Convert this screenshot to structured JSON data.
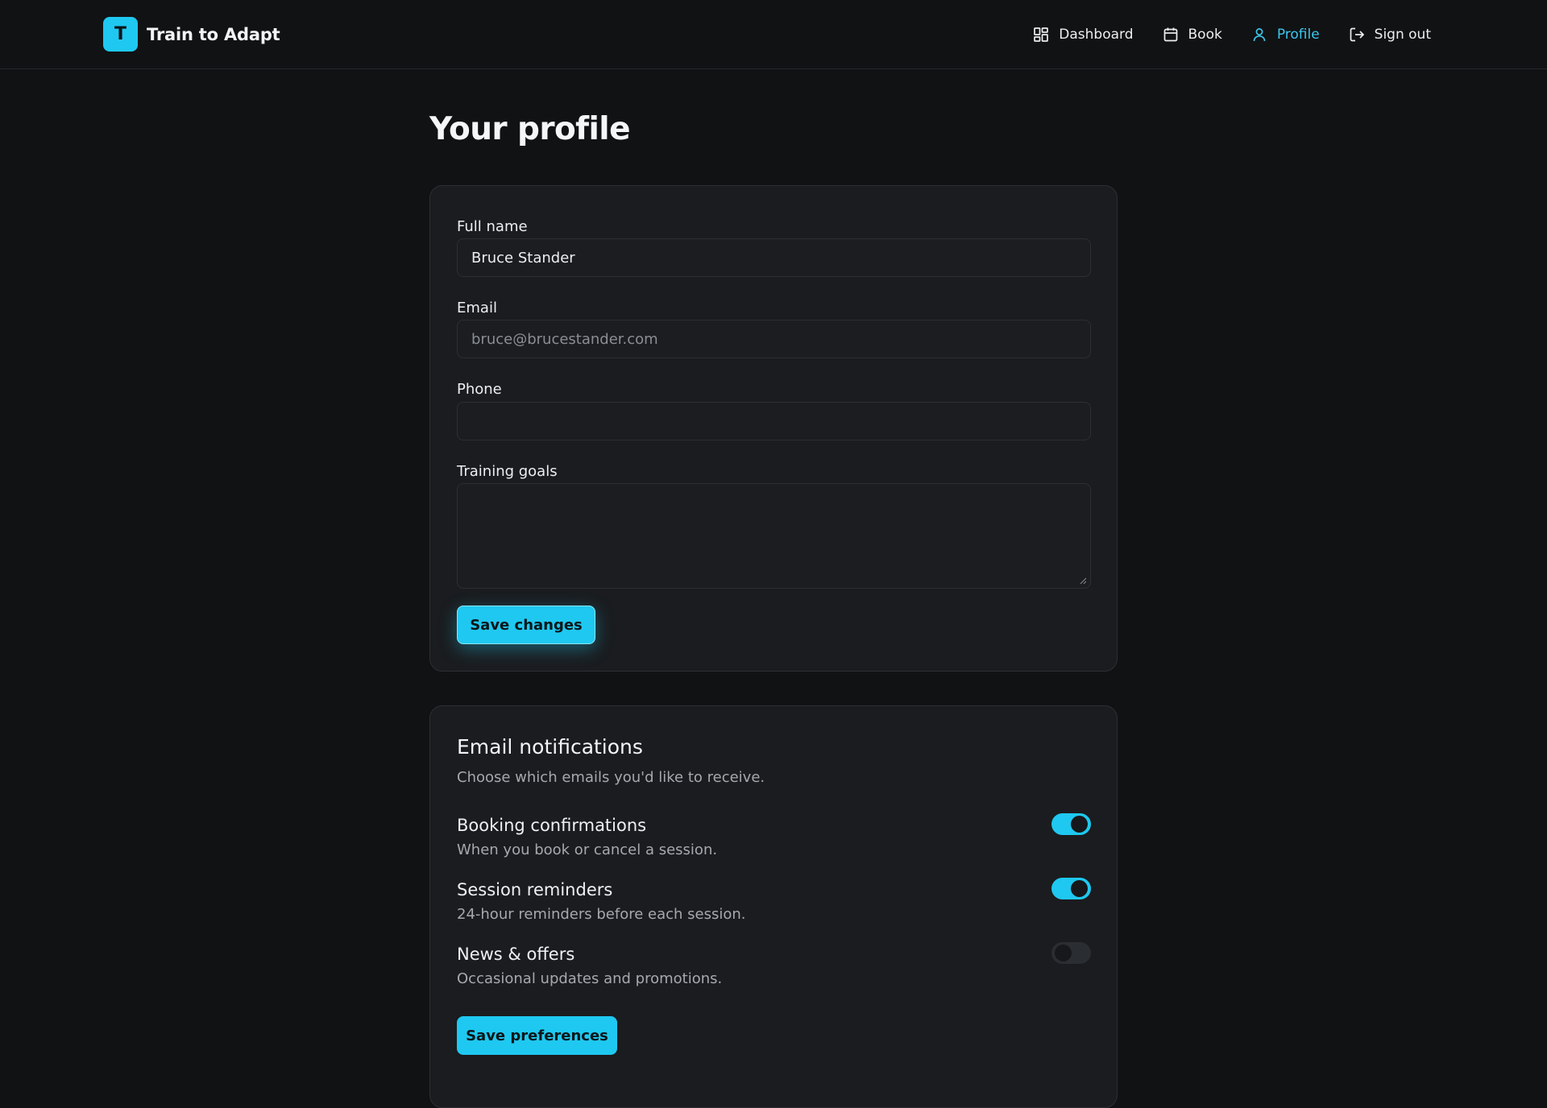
{
  "brand": {
    "logo_letter": "T",
    "name": "Train to Adapt"
  },
  "nav": {
    "dashboard": "Dashboard",
    "book": "Book",
    "profile": "Profile",
    "sign_out": "Sign out"
  },
  "page": {
    "title": "Your profile"
  },
  "profile_form": {
    "full_name_label": "Full name",
    "full_name_value": "Bruce Stander",
    "email_label": "Email",
    "email_value": "bruce@brucestander.com",
    "phone_label": "Phone",
    "phone_value": "",
    "goals_label": "Training goals",
    "goals_value": "",
    "save_label": "Save changes"
  },
  "notifications": {
    "title": "Email notifications",
    "subtitle": "Choose which emails you'd like to receive.",
    "items": [
      {
        "title": "Booking confirmations",
        "desc": "When you book or cancel a session.",
        "enabled": true
      },
      {
        "title": "Session reminders",
        "desc": "24-hour reminders before each session.",
        "enabled": true
      },
      {
        "title": "News & offers",
        "desc": "Occasional updates and promotions.",
        "enabled": false
      }
    ],
    "save_label": "Save preferences"
  },
  "colors": {
    "accent": "#1fc8f0",
    "background": "#111214",
    "card": "#1a1c1f",
    "active_nav": "#3cc6ec"
  },
  "icons": {
    "dashboard": "dashboard-grid-icon",
    "book": "calendar-icon",
    "profile": "user-icon",
    "sign_out": "sign-out-icon"
  }
}
